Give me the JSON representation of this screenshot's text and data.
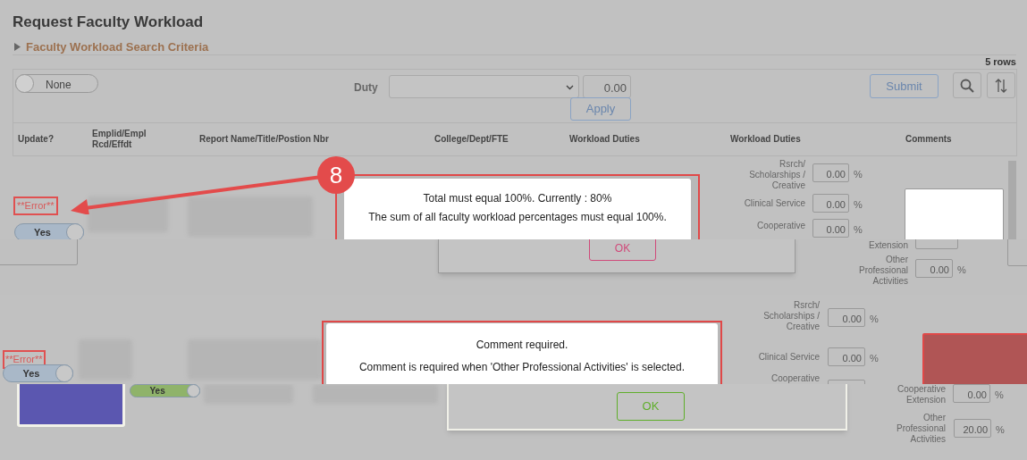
{
  "title": "Request Faculty Workload",
  "search_criteria": {
    "label": "Faculty Workload Search Criteria",
    "expanded": false
  },
  "row_count": "5 rows",
  "toolbar": {
    "toggle": {
      "label": "None",
      "on": false
    },
    "duty_label": "Duty",
    "duty_amount": "0.00",
    "apply": "Apply",
    "submit": "Submit"
  },
  "columns": [
    "Update?",
    "Emplid/Empl Rcd/Effdt",
    "Report Name/Title/Postion Nbr",
    "College/Dept/FTE",
    "Workload Duties",
    "Workload Duties",
    "Comments"
  ],
  "rows": [
    {
      "error": "**Error**",
      "update": {
        "label": "Yes",
        "on": true,
        "color": "#a9b8c8"
      },
      "dialog": {
        "badge": "8",
        "title": "Total must equal 100%. Currently : 80%",
        "message": "The sum of all faculty workload percentages must equal 100%.",
        "ok": {
          "label": "OK",
          "color": "#d04a7a"
        }
      },
      "upper_duties": [
        {
          "label": "Rsrch/ Scholarships / Creative",
          "value": "0.00",
          "unit": "%"
        },
        {
          "label": "Clinical Service",
          "value": "0.00",
          "unit": "%"
        },
        {
          "label": "Cooperative",
          "value": "0.00",
          "unit": "%"
        }
      ],
      "lower_duties": [
        {
          "label": "Extension"
        },
        {
          "label": "Other Professional Activities",
          "value": "0.00",
          "unit": "%"
        }
      ],
      "comment_error": false
    },
    {
      "error": "**Error**",
      "update": {
        "label": "Yes",
        "on": true,
        "color": "#a9b8c8"
      },
      "update_lower": {
        "label": "Yes",
        "on": true,
        "color": "#8fb36a"
      },
      "dialog": {
        "title": "Comment required.",
        "message": "Comment is required when 'Other Professional Activities' is selected.",
        "ok": {
          "label": "OK",
          "color": "#5fae2a"
        }
      },
      "upper_duties": [
        {
          "label": "Rsrch/ Scholarships / Creative",
          "value": "0.00",
          "unit": "%"
        },
        {
          "label": "Clinical Service",
          "value": "0.00",
          "unit": "%"
        },
        {
          "label": "Cooperative"
        }
      ],
      "lower_duties": [
        {
          "label": "Cooperative Extension",
          "value": "0.00",
          "unit": "%"
        },
        {
          "label": "Other Professional Activities",
          "value": "20.00",
          "unit": "%"
        }
      ],
      "comment_error": true,
      "note": {
        "color": "#5b57b0"
      }
    }
  ]
}
